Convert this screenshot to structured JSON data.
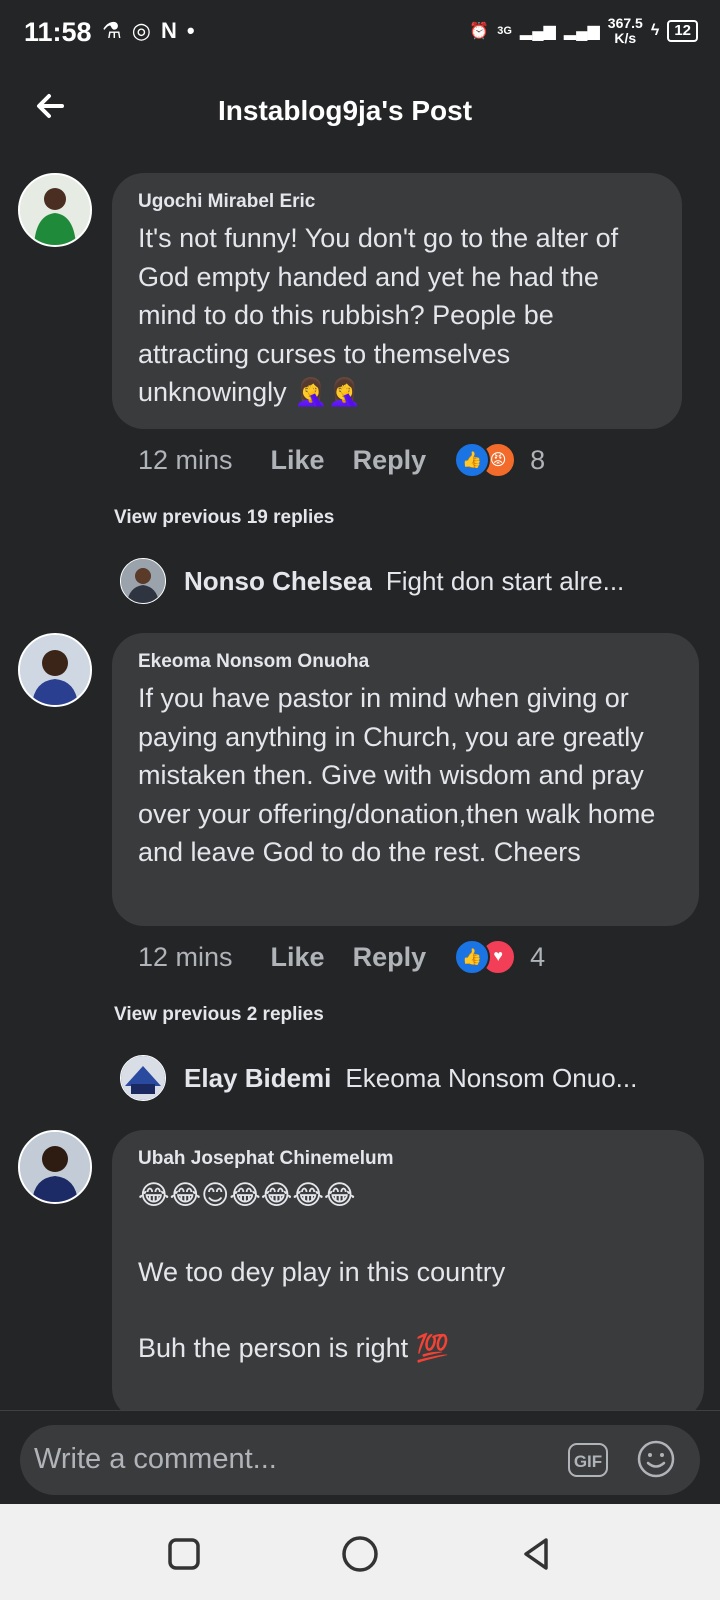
{
  "status_bar": {
    "time": "11:58",
    "network_type": "3G",
    "speed_value": "367.5",
    "speed_unit": "K/s",
    "battery": "12"
  },
  "header": {
    "title": "Instablog9ja's Post"
  },
  "comments": [
    {
      "author": "Ugochi Mirabel Eric",
      "text": "It's not funny! You don't go to the alter of God empty handed and yet he had the mind to do this rubbish? People be attracting curses to themselves unknowingly 🤦‍♀️🤦‍♀️",
      "time": "12 mins",
      "like_label": "Like",
      "reply_label": "Reply",
      "reactions": [
        "like",
        "angry"
      ],
      "reaction_count": "8",
      "view_previous": "View previous 19 replies",
      "latest_reply": {
        "author": "Nonso Chelsea",
        "text": "Fight don start alre..."
      }
    },
    {
      "author": "Ekeoma Nonsom Onuoha",
      "text": "If you have pastor in mind when giving or paying anything in Church, you are greatly mistaken then. Give with wisdom and pray over your offering/donation,then walk home and leave God to do the rest. Cheers",
      "time": "12 mins",
      "like_label": "Like",
      "reply_label": "Reply",
      "reactions": [
        "like",
        "love"
      ],
      "reaction_count": "4",
      "view_previous": "View previous 2 replies",
      "latest_reply": {
        "author": "Elay Bidemi",
        "text": "Ekeoma Nonsom Onuo..."
      }
    },
    {
      "author": "Ubah Josephat Chinemelum",
      "emojis": "😂😂😊😂😂😂😂",
      "line1": "We too dey play in this country",
      "line2": "Buh the person is right 💯"
    }
  ],
  "composer": {
    "placeholder": "Write a comment...",
    "gif_label": "GIF"
  },
  "colors": {
    "background": "#242526",
    "bubble": "#3a3b3c",
    "accent_like": "#1b74e4"
  }
}
